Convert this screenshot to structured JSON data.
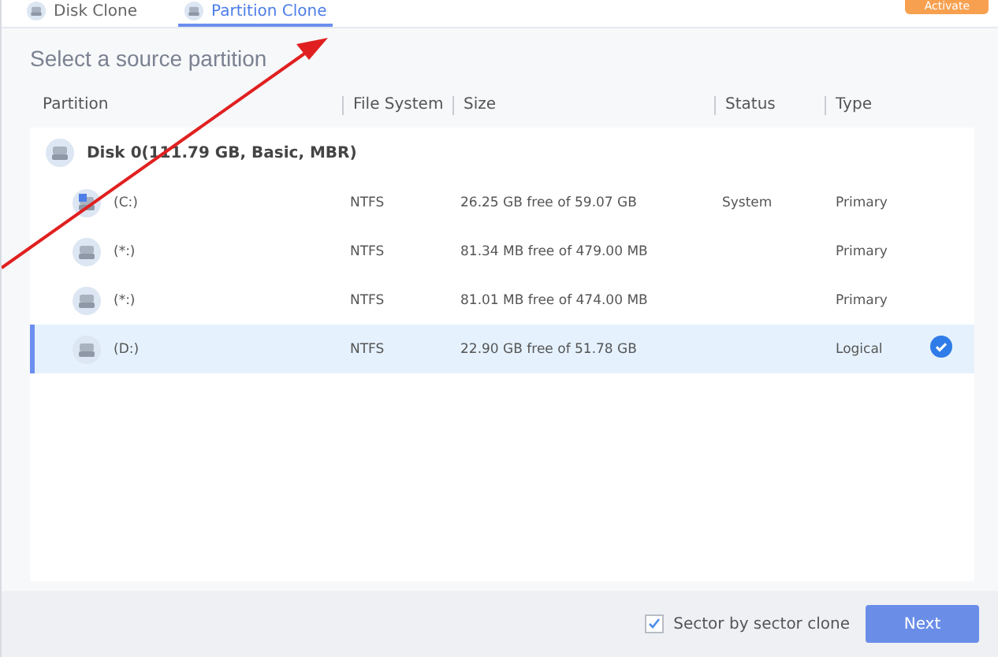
{
  "tabs": [
    {
      "label": "Disk Clone",
      "selected": false
    },
    {
      "label": "Partition Clone",
      "selected": true
    }
  ],
  "activate_button": "Activate",
  "heading": "Select a source partition",
  "table": {
    "columns": [
      "Partition",
      "File System",
      "Size",
      "Status",
      "Type"
    ],
    "disk": "Disk 0(111.79 GB, Basic, MBR)",
    "rows": [
      {
        "partition": "(C:)",
        "file_system": "NTFS",
        "size": "26.25 GB free of 59.07 GB",
        "status": "System",
        "type": "Primary",
        "selected": false,
        "kind": "system"
      },
      {
        "partition": "(*:)",
        "file_system": "NTFS",
        "size": "81.34 MB free of 479.00 MB",
        "status": "",
        "type": "Primary",
        "selected": false,
        "kind": "drive"
      },
      {
        "partition": "(*:)",
        "file_system": "NTFS",
        "size": "81.01 MB free of 474.00 MB",
        "status": "",
        "type": "Primary",
        "selected": false,
        "kind": "drive"
      },
      {
        "partition": "(D:)",
        "file_system": "NTFS",
        "size": "22.90 GB free of 51.78 GB",
        "status": "",
        "type": "Logical",
        "selected": true,
        "kind": "drive"
      }
    ]
  },
  "footer": {
    "sector_by_sector": {
      "label": "Sector by sector clone",
      "checked": true
    },
    "next_button": "Next"
  }
}
